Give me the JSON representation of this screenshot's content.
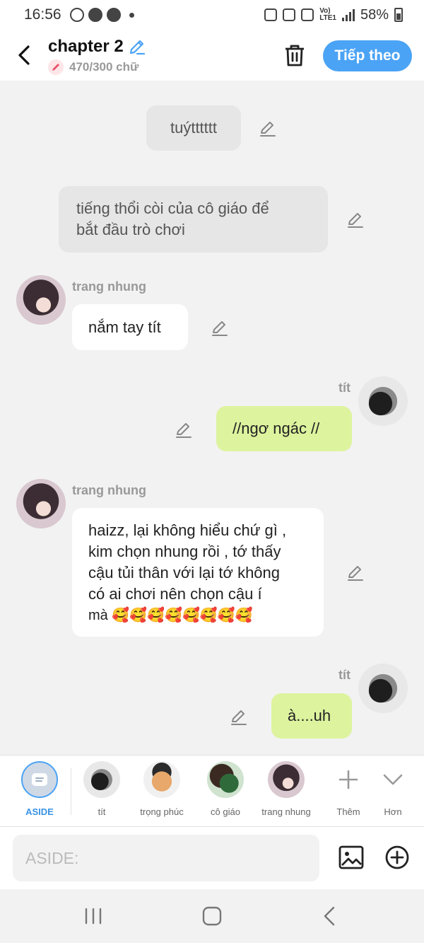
{
  "status_bar": {
    "time": "16:56",
    "battery": "58%"
  },
  "header": {
    "title": "chapter 2",
    "word_count": "470/300 chữ",
    "next_label": "Tiếp theo"
  },
  "messages": [
    {
      "type": "narration",
      "text": "tuýtttttt"
    },
    {
      "type": "narration",
      "lines": [
        "tiếng thổi còi của cô giáo để",
        "bắt đầu trò chơi"
      ]
    },
    {
      "type": "left",
      "sender": "trang nhung",
      "lines": [
        "nắm tay tít"
      ]
    },
    {
      "type": "right",
      "sender": "tít",
      "lines": [
        "//ngơ ngác //"
      ]
    },
    {
      "type": "left",
      "sender": "trang nhung",
      "lines": [
        "haizz, lại không hiểu chứ gì ,",
        "kim chọn nhung rồi , tớ thấy",
        "cậu tủi thân với lại tớ không",
        "có ai chơi nên chọn cậu í",
        "mà 🥰🥰🥰🥰🥰🥰🥰🥰"
      ]
    },
    {
      "type": "right",
      "sender": "tít",
      "lines": [
        "à....uh"
      ]
    }
  ],
  "characters": {
    "aside": "ASIDE",
    "tit": "tít",
    "trong_phuc": "trọng phúc",
    "co_giao": "cô giáo",
    "trang_nhung": "trang nhung",
    "more": "Thêm",
    "less": "Hơn"
  },
  "input": {
    "placeholder": "ASIDE:"
  },
  "colors": {
    "accent": "#4ba3f5",
    "my_bubble": "#ddf39e",
    "narration_bubble": "#e6e6e6"
  }
}
